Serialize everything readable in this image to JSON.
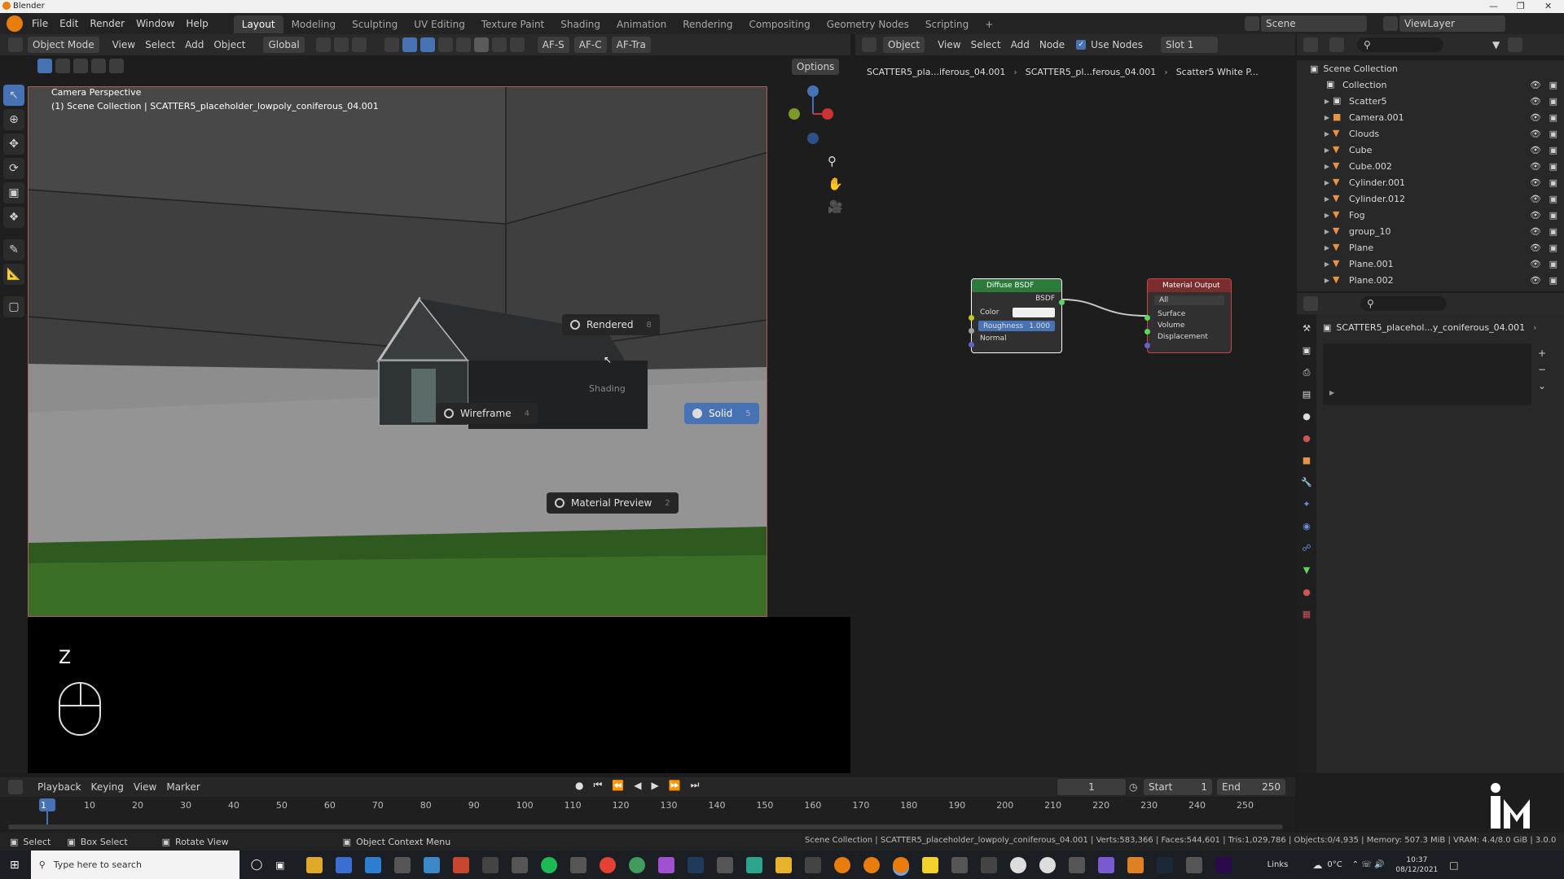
{
  "window": {
    "title": "Blender",
    "logo": "blender-icon"
  },
  "menu": [
    "File",
    "Edit",
    "Render",
    "Window",
    "Help"
  ],
  "workspaces": [
    "Layout",
    "Modeling",
    "Sculpting",
    "UV Editing",
    "Texture Paint",
    "Shading",
    "Animation",
    "Rendering",
    "Compositing",
    "Geometry Nodes",
    "Scripting"
  ],
  "active_workspace": "Layout",
  "scene": {
    "label": "Scene",
    "view_layer": "ViewLayer"
  },
  "viewport_header": {
    "mode": "Object Mode",
    "items": [
      "View",
      "Select",
      "Add",
      "Object"
    ],
    "orientation": "Global",
    "addons": [
      "AF-S",
      "AF-C",
      "AF-Tra"
    ],
    "options": "Options"
  },
  "viewport": {
    "title": "Camera Perspective",
    "subtitle": "(1) Scene Collection | SCATTER5_placeholder_lowpoly_coniferous_04.001",
    "key_hint": "Z"
  },
  "pie_menu": {
    "title": "Shading",
    "items": [
      {
        "label": "Rendered",
        "key": "8"
      },
      {
        "label": "Wireframe",
        "key": "4"
      },
      {
        "label": "Solid",
        "key": "5"
      },
      {
        "label": "Material Preview",
        "key": "2"
      }
    ],
    "selected": "Solid"
  },
  "node_header": {
    "type": "Object",
    "items": [
      "View",
      "Select",
      "Add",
      "Node"
    ],
    "use_nodes_label": "Use Nodes",
    "slot": "Slot 1"
  },
  "node_breadcrumb": [
    "SCATTER5_pla...iferous_04.001",
    "SCATTER5_pl...ferous_04.001",
    "Scatter5 White P..."
  ],
  "nodes": {
    "diffuse": {
      "title": "Diffuse BSDF",
      "output": "BSDF",
      "inputs": [
        "Color",
        "Roughness",
        "Normal"
      ],
      "roughness": "1.000"
    },
    "output": {
      "title": "Material Output",
      "target": "All",
      "inputs": [
        "Surface",
        "Volume",
        "Displacement"
      ]
    }
  },
  "outliner": {
    "root": "Scene Collection",
    "items": [
      {
        "name": "Collection",
        "indent": 1
      },
      {
        "name": "Scatter5",
        "indent": 2
      },
      {
        "name": "Camera.001",
        "indent": 2
      },
      {
        "name": "Clouds",
        "indent": 2
      },
      {
        "name": "Cube",
        "indent": 2
      },
      {
        "name": "Cube.002",
        "indent": 2
      },
      {
        "name": "Cylinder.001",
        "indent": 2
      },
      {
        "name": "Cylinder.012",
        "indent": 2
      },
      {
        "name": "Fog",
        "indent": 2
      },
      {
        "name": "group_10",
        "indent": 2
      },
      {
        "name": "Plane",
        "indent": 2
      },
      {
        "name": "Plane.001",
        "indent": 2
      },
      {
        "name": "Plane.002",
        "indent": 2
      }
    ]
  },
  "properties": {
    "object": "SCATTER5_placehol...y_coniferous_04.001"
  },
  "timeline": {
    "items": [
      "Playback",
      "Keying",
      "View",
      "Marker"
    ],
    "current": "1",
    "start_label": "Start",
    "start": "1",
    "end_label": "End",
    "end": "250",
    "ticks": [
      "1",
      "10",
      "20",
      "30",
      "40",
      "50",
      "60",
      "70",
      "80",
      "90",
      "100",
      "110",
      "120",
      "130",
      "140",
      "150",
      "160",
      "170",
      "180",
      "190",
      "200",
      "210",
      "220",
      "230",
      "240",
      "250"
    ]
  },
  "status": {
    "select": "Select",
    "box_select": "Box Select",
    "rotate": "Rotate View",
    "context": "Object Context Menu",
    "stats": "Scene Collection | SCATTER5_placeholder_lowpoly_coniferous_04.001 | Verts:583,366 | Faces:544,601 | Tris:1,029,786 | Objects:0/4,935 | Memory: 507.3 MiB | VRAM: 4.4/8.0 GiB | 3.0.0"
  },
  "taskbar": {
    "search_placeholder": "Type here to search",
    "links": "Links",
    "temp": "0°C",
    "time": "10:37",
    "date": "08/12/2021"
  }
}
